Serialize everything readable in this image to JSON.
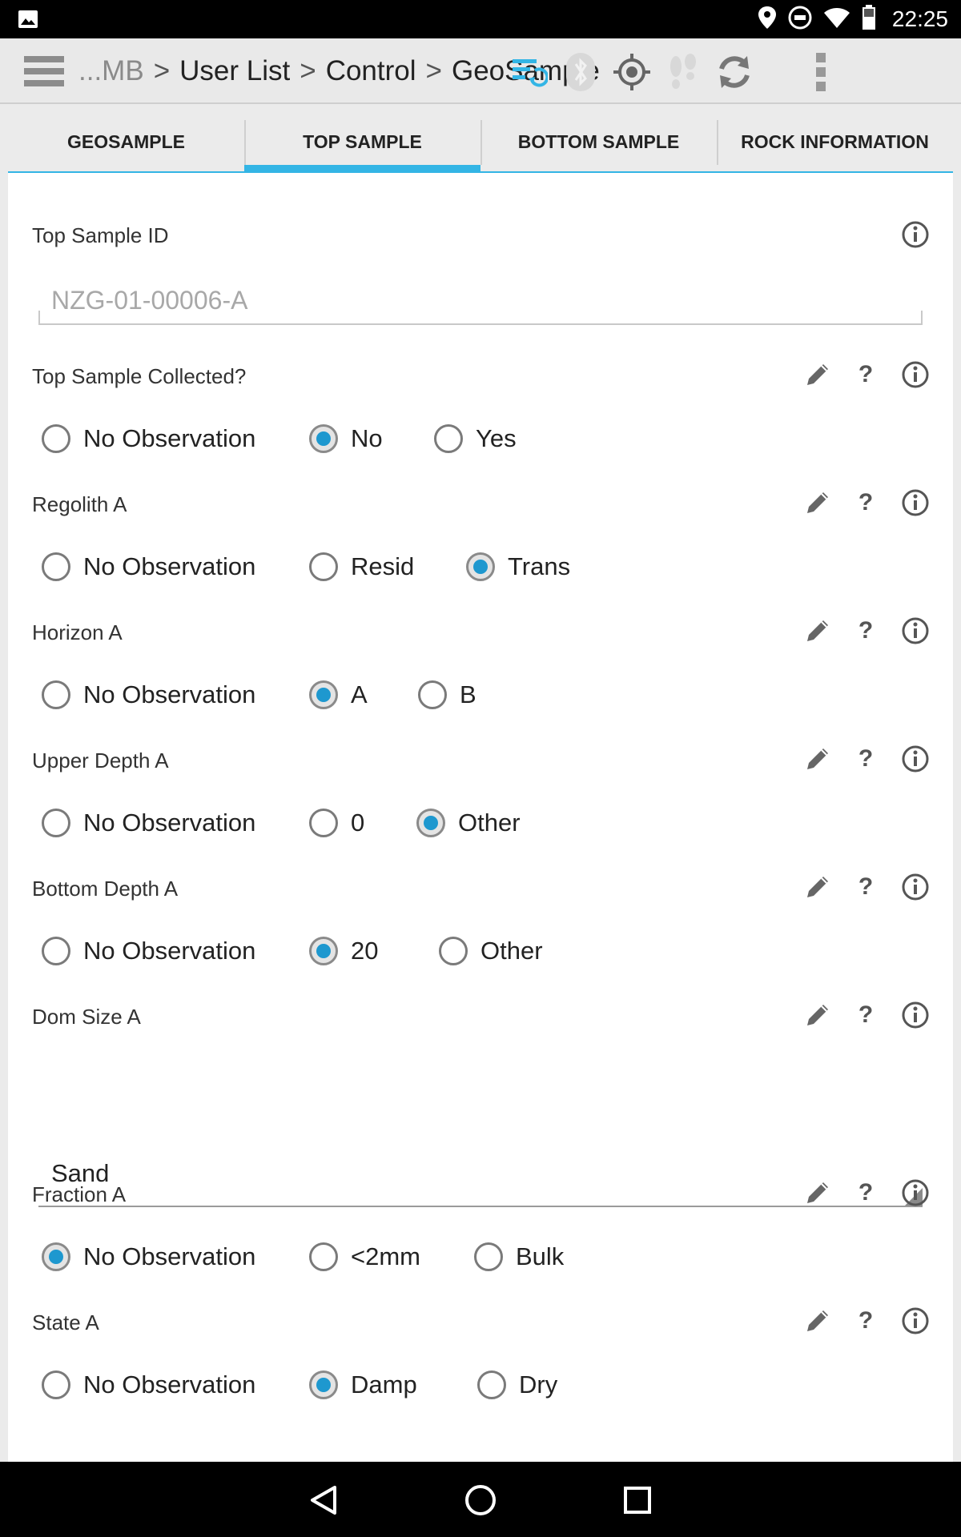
{
  "status_bar": {
    "time": "22:25",
    "icons": [
      "image-icon",
      "location-icon",
      "do-not-disturb-icon",
      "wifi-icon",
      "battery-icon"
    ]
  },
  "action_bar": {
    "breadcrumb": [
      "...MB",
      "User List",
      "Control",
      "GeoSample"
    ],
    "separator": ">",
    "actions": [
      "sync-list-icon",
      "bluetooth-icon",
      "gps-icon",
      "footsteps-icon",
      "refresh-icon",
      "overflow-menu-icon"
    ],
    "accent_color": "#33b5e5"
  },
  "tabs": [
    {
      "label": "GEOSAMPLE",
      "active": false
    },
    {
      "label": "TOP SAMPLE",
      "active": true
    },
    {
      "label": "BOTTOM SAMPLE",
      "active": false
    },
    {
      "label": "ROCK INFORMATION",
      "active": false
    }
  ],
  "form": {
    "top_sample_id": {
      "label": "Top Sample ID",
      "placeholder": "NZG-01-00006-A",
      "value": ""
    },
    "top_sample_collected": {
      "label": "Top Sample Collected?",
      "options": [
        "No Observation",
        "No",
        "Yes"
      ],
      "selected": "No"
    },
    "regolith_a": {
      "label": "Regolith A",
      "options": [
        "No Observation",
        "Resid",
        "Trans"
      ],
      "selected": "Trans"
    },
    "horizon_a": {
      "label": "Horizon A",
      "options": [
        "No Observation",
        "A",
        "B"
      ],
      "selected": "A"
    },
    "upper_depth_a": {
      "label": "Upper Depth A",
      "options": [
        "No Observation",
        "0",
        "Other"
      ],
      "selected": "Other"
    },
    "bottom_depth_a": {
      "label": "Bottom Depth A",
      "options": [
        "No Observation",
        "20",
        "Other"
      ],
      "selected": "20"
    },
    "dom_size_a": {
      "label": "Dom Size A",
      "value": "Sand"
    },
    "fraction_a": {
      "label": "Fraction A",
      "options": [
        "No Observation",
        "<2mm",
        "Bulk"
      ],
      "selected": "No Observation"
    },
    "state_a": {
      "label": "State A",
      "options": [
        "No Observation",
        "Damp",
        "Dry"
      ],
      "selected": "Damp"
    },
    "field_action_icons": [
      "pencil-icon",
      "help-icon",
      "info-icon"
    ],
    "help_glyph": "?",
    "radio_color": "#1e98cf"
  },
  "nav_bar": {
    "icons": [
      "back-icon",
      "home-icon",
      "recents-icon"
    ]
  }
}
